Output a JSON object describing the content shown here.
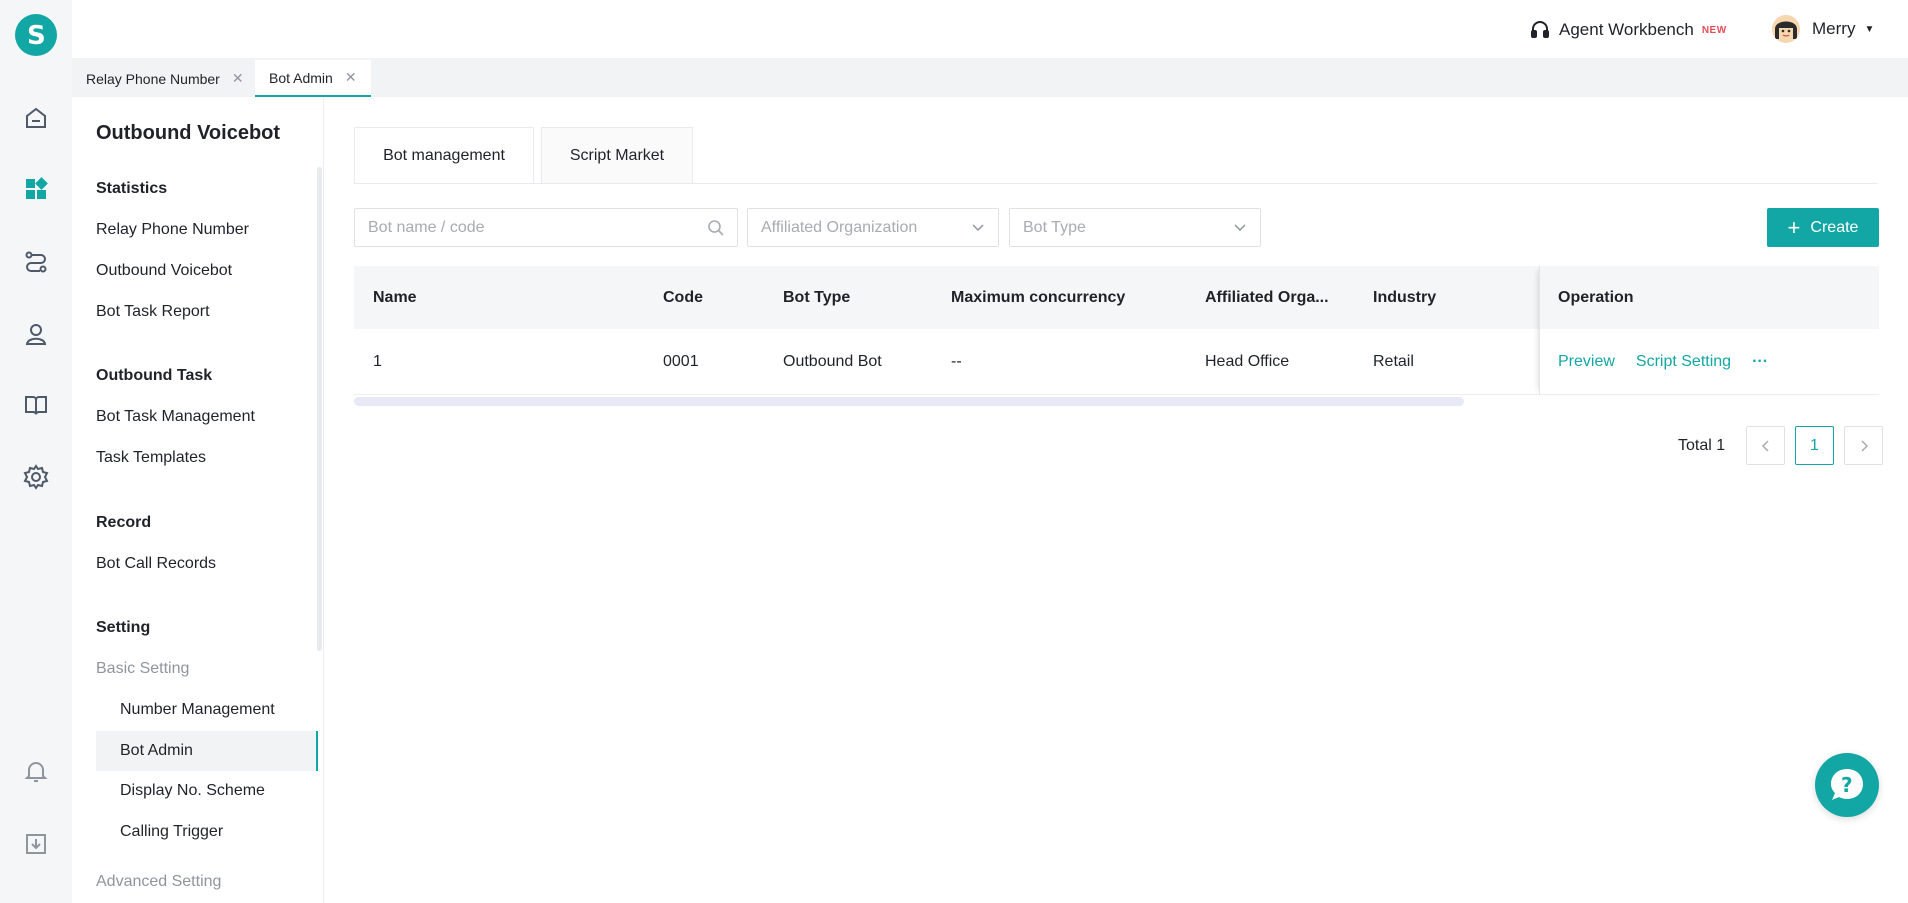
{
  "topbar": {
    "workbench_label": "Agent Workbench",
    "workbench_badge": "NEW",
    "user_name": "Merry"
  },
  "page_tabs": [
    {
      "label": "Relay Phone Number"
    },
    {
      "label": "Bot Admin"
    }
  ],
  "sidebar": {
    "title": "Outbound Voicebot",
    "groups": [
      {
        "label": "Statistics",
        "items": [
          "Relay Phone Number",
          "Outbound Voicebot",
          "Bot Task Report"
        ]
      },
      {
        "label": "Outbound Task",
        "items": [
          "Bot Task Management",
          "Task Templates"
        ]
      },
      {
        "label": "Record",
        "items": [
          "Bot Call Records"
        ]
      },
      {
        "label": "Setting",
        "basic": "Basic Setting",
        "items": [
          "Number Management",
          "Bot Admin",
          "Display No. Scheme",
          "Calling Trigger"
        ],
        "advanced": "Advanced Setting"
      }
    ]
  },
  "content_tabs": [
    {
      "label": "Bot management"
    },
    {
      "label": "Script Market"
    }
  ],
  "filters": {
    "search_placeholder": "Bot name / code",
    "org_placeholder": "Affiliated Organization",
    "type_placeholder": "Bot Type"
  },
  "create_label": "Create",
  "table": {
    "headers": [
      "Name",
      "Code",
      "Bot Type",
      "Maximum concurrency",
      "Affiliated Orga...",
      "Industry",
      "Operation"
    ],
    "rows": [
      {
        "name": "1",
        "code": "0001",
        "type": "Outbound Bot",
        "concurrency": "--",
        "org": "Head Office",
        "industry": "Retail"
      }
    ],
    "ops": {
      "preview": "Preview",
      "script": "Script Setting",
      "more": "···"
    }
  },
  "pagination": {
    "total_label": "Total 1",
    "current": "1"
  },
  "colors": {
    "accent": "#12a7a4",
    "badge": "#e34d59"
  }
}
